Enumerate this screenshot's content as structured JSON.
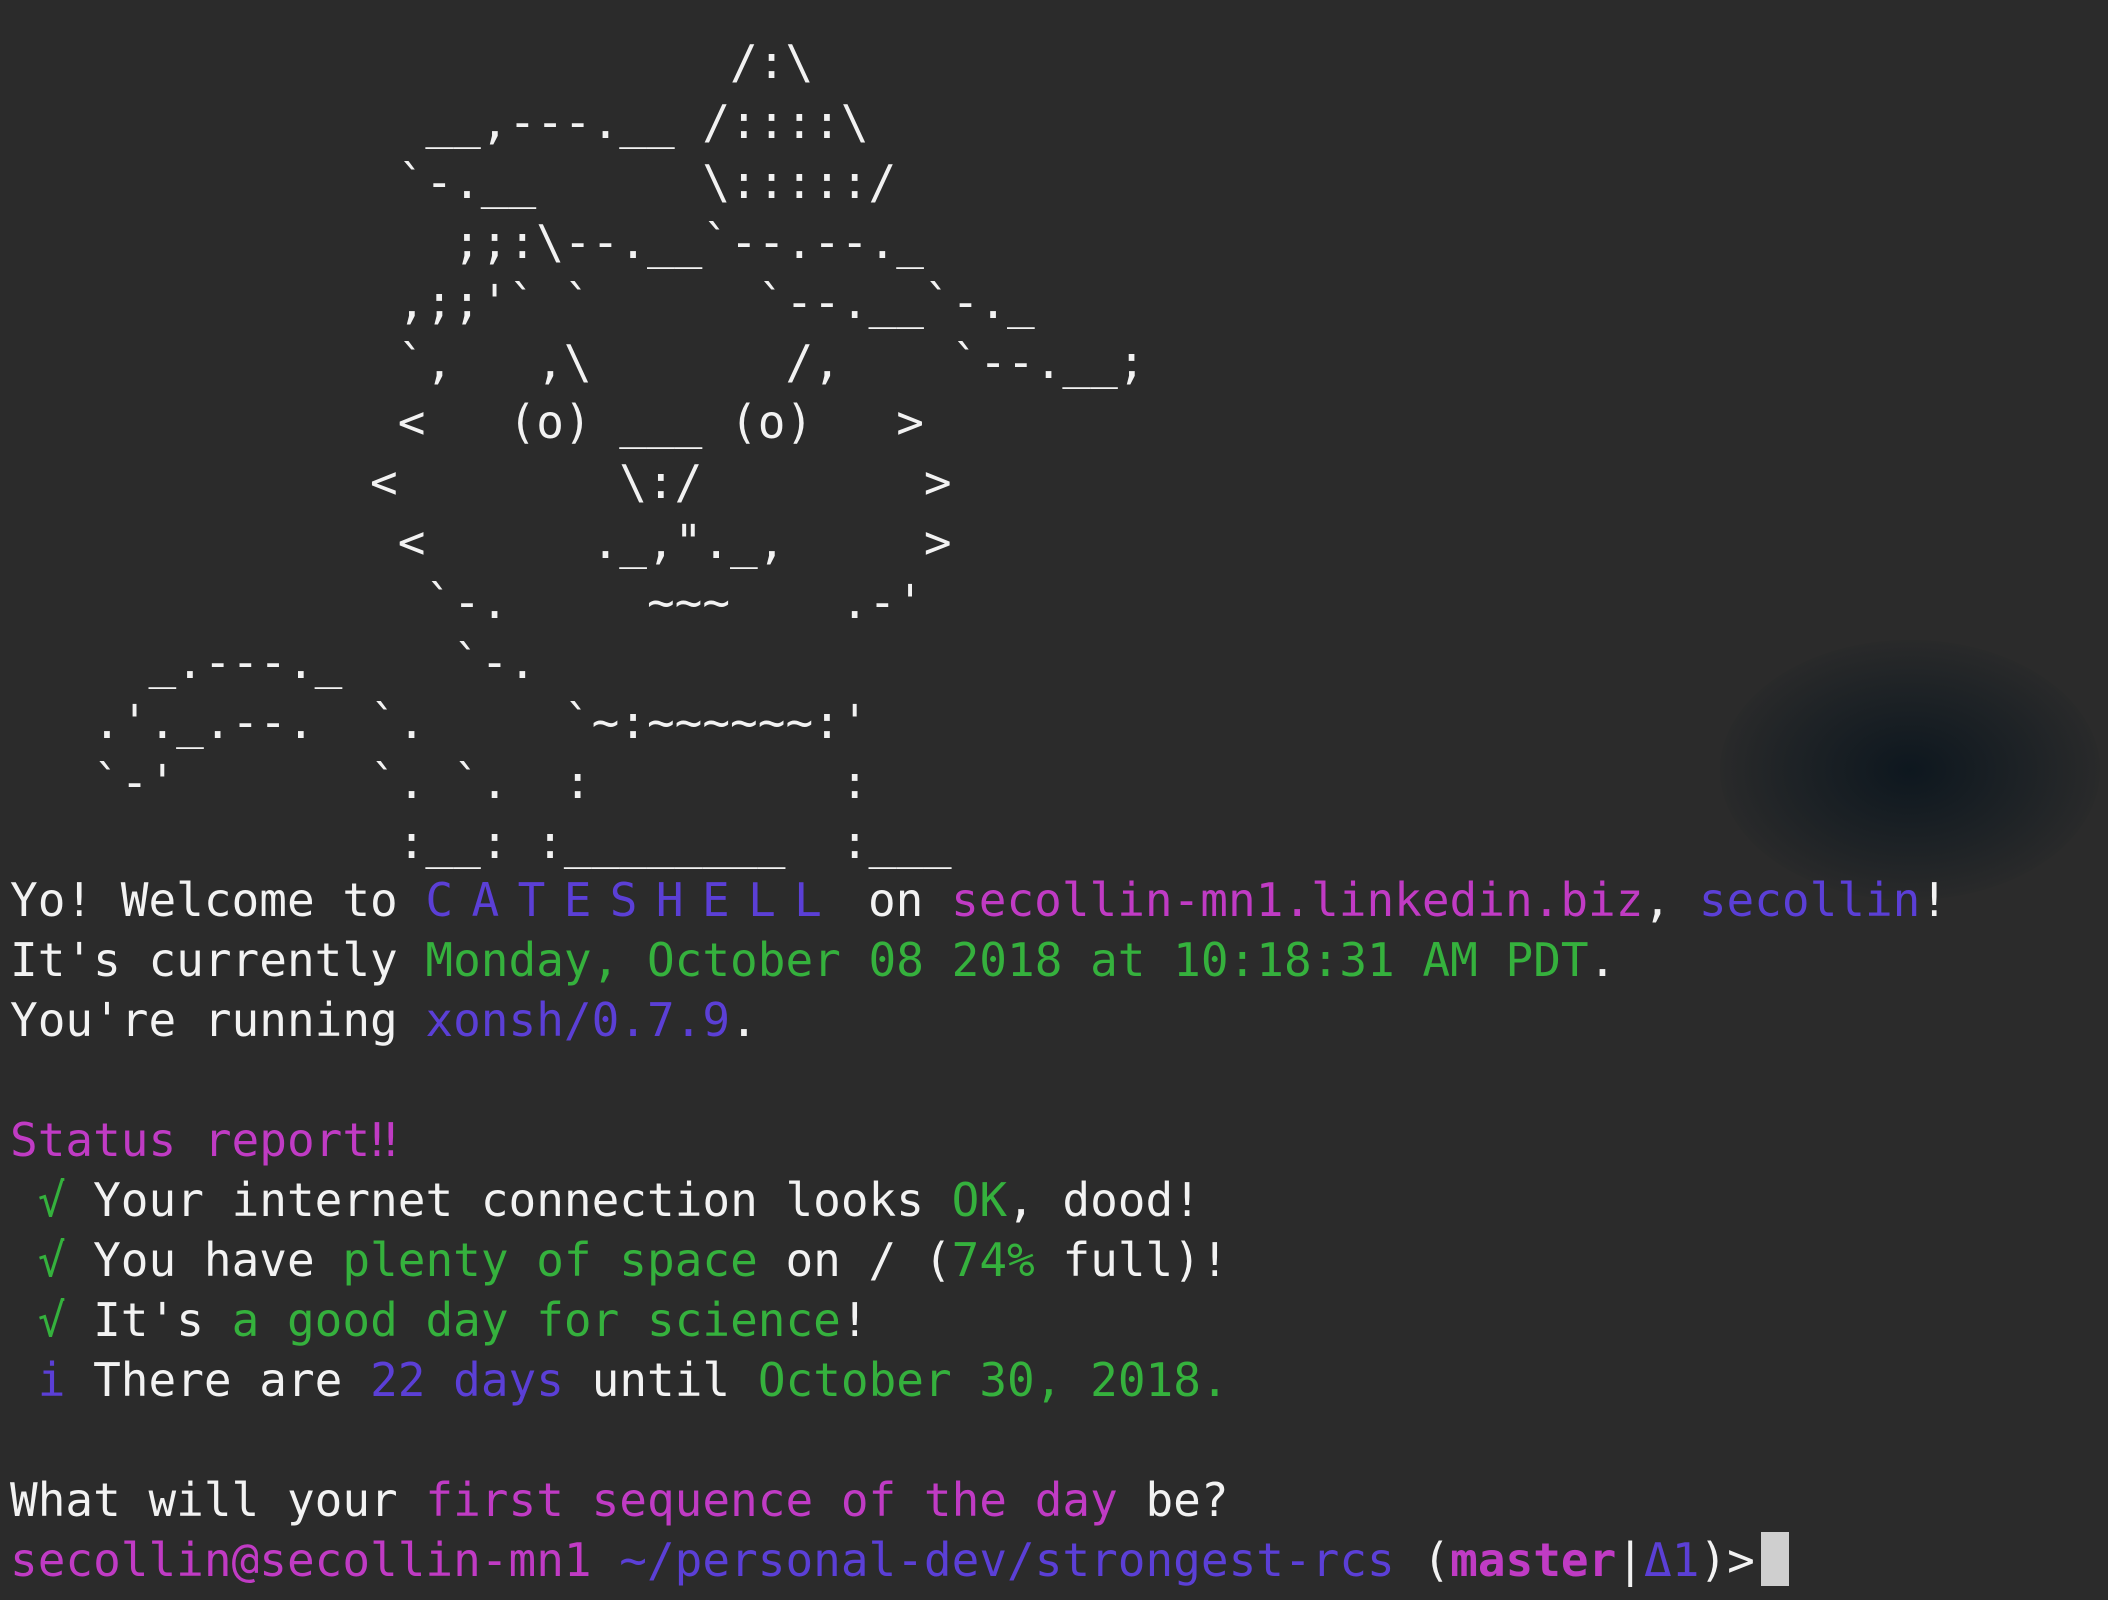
{
  "ascii_art": {
    "lines": [
      "                          /:\\",
      "               __,---.__ /::::\\",
      "              `-.__      \\:::::/",
      "                ;;:\\--.__`--.--._",
      "              ,;;'` `      `--.__`-._",
      "              `,   ,\\       /,    `--.__;",
      "              <   (o) ___ (o)   >",
      "             <        \\:/        >",
      "              <      ._,\"._,     >",
      "               `-.     ~~~    .-'",
      "     _.---._    `-.",
      "   .'._.--.  `.     `~:~~~~~~:'",
      "   `-'       `. `.  :         :",
      "              :__: :________  :___"
    ]
  },
  "welcome": {
    "line1": {
      "prefix": "Yo! Welcome to ",
      "shell_name": "CATESHELL",
      "on": " on ",
      "host": "secollin-mn1.linkedin.biz",
      "comma": ", ",
      "user": "secollin",
      "bang": "!"
    },
    "line2": {
      "prefix": "It's currently ",
      "datetime": "Monday, October 08 2018 at 10:18:31 AM PDT",
      "suffix": "."
    },
    "line3": {
      "prefix": "You're running ",
      "version": "xonsh/0.7.9",
      "suffix": "."
    }
  },
  "status": {
    "title": "Status report‼",
    "items": [
      {
        "icon": "√",
        "parts": [
          {
            "text": "Your internet connection looks ",
            "color": "white"
          },
          {
            "text": "OK",
            "color": "green"
          },
          {
            "text": ", dood!",
            "color": "white"
          }
        ]
      },
      {
        "icon": "√",
        "parts": [
          {
            "text": "You have ",
            "color": "white"
          },
          {
            "text": "plenty of space",
            "color": "green"
          },
          {
            "text": " on / (",
            "color": "white"
          },
          {
            "text": "74%",
            "color": "green"
          },
          {
            "text": " full)!",
            "color": "white"
          }
        ]
      },
      {
        "icon": "√",
        "parts": [
          {
            "text": "It's ",
            "color": "white"
          },
          {
            "text": "a good day for science",
            "color": "green"
          },
          {
            "text": "!",
            "color": "white"
          }
        ]
      },
      {
        "icon": "i",
        "parts": [
          {
            "text": "There are ",
            "color": "white"
          },
          {
            "text": "22 days",
            "color": "purple"
          },
          {
            "text": " until ",
            "color": "white"
          },
          {
            "text": "October 30, 2018.",
            "color": "green"
          }
        ]
      }
    ]
  },
  "question": {
    "prefix": "What will your ",
    "highlight": "first sequence of the day",
    "suffix": " be?"
  },
  "prompt": {
    "user_host": "secollin@secollin-mn1",
    "path": " ~/personal-dev/strongest-rcs ",
    "open_paren": "(",
    "branch": "master",
    "separator": "|",
    "changes": "Δ1",
    "close": ")>"
  },
  "colors": {
    "background": "#2b2b2b",
    "text": "#f2f2f2",
    "purple": "#5b3fd6",
    "magenta": "#c03bc4",
    "green": "#35b13d"
  }
}
